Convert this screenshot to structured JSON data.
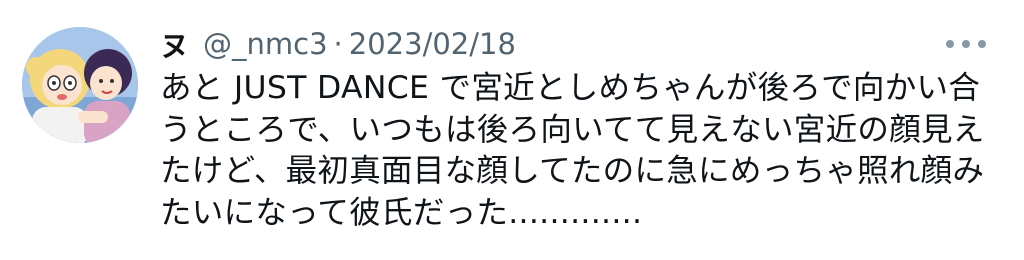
{
  "tweet": {
    "display_name": "ヌ",
    "handle": "@_nmc3",
    "separator": "·",
    "date": "2023/02/18",
    "more_icon": "more-horizontal-icon",
    "avatar_icon": "anime-avatar",
    "lines": [
      "あと JUST DANCE で宮近としめちゃんが後ろで向かい合",
      "うところで、いつもは後ろ向いてて見えない宮近の顔見え",
      "たけど、最初真面目な顔してたのに急にめっちゃ照れ顔み",
      "たいになって彼氏だった............."
    ]
  },
  "colors": {
    "text": "#0f1419",
    "secondary": "#536471",
    "icon": "#8b98a5",
    "background": "#ffffff"
  }
}
